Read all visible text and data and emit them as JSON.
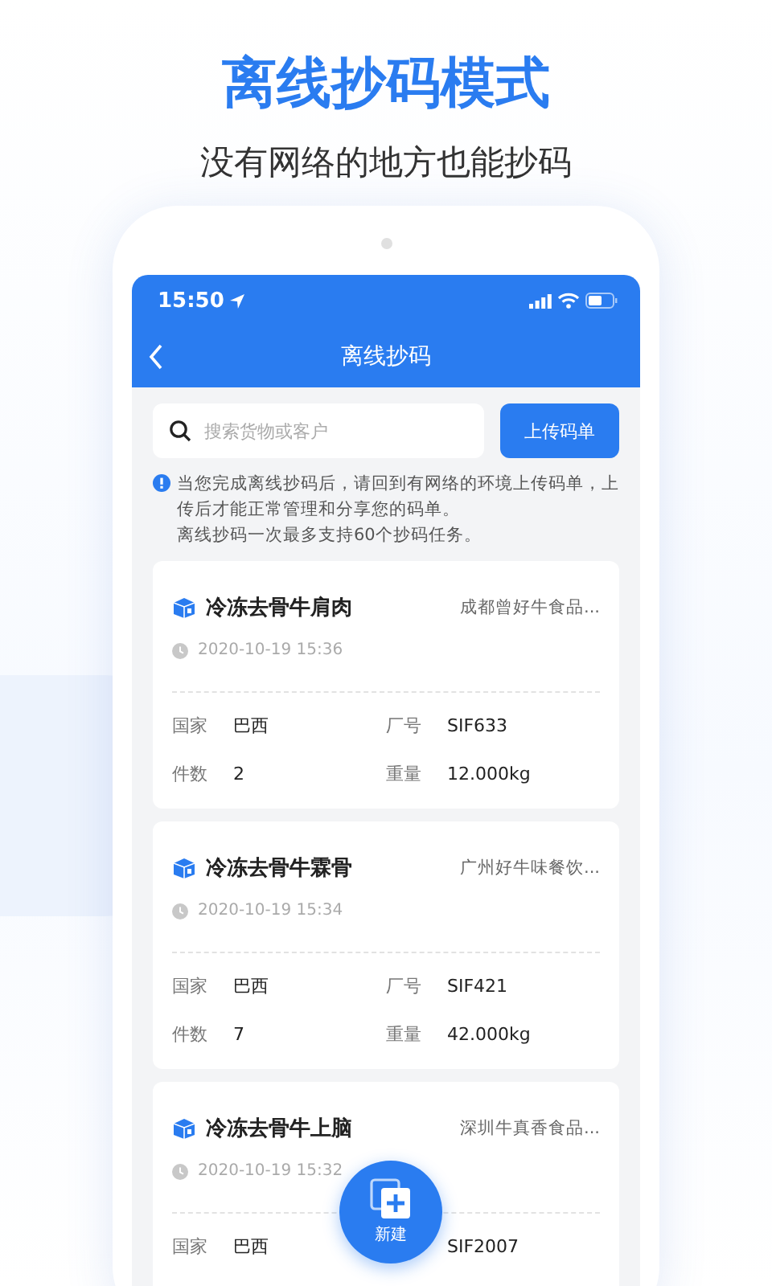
{
  "headline": "离线抄码模式",
  "subheadline": "没有网络的地方也能抄码",
  "status_bar": {
    "time": "15:50"
  },
  "nav": {
    "title": "离线抄码"
  },
  "search": {
    "placeholder": "搜索货物或客户"
  },
  "upload_button": "上传码单",
  "notice": [
    "当您完成离线抄码后，请回到有网络的环境上传码单，上传后才能正常管理和分享您的码单。",
    "离线抄码一次最多支持60个抄码任务。"
  ],
  "records": [
    {
      "name": "冷冻去骨牛肩肉",
      "customer": "成都曾好牛食品...",
      "time": "2020-10-19 15:36",
      "fields": [
        {
          "label": "国家",
          "value": "巴西"
        },
        {
          "label": "厂号",
          "value": "SIF633"
        },
        {
          "label": "件数",
          "value": "2"
        },
        {
          "label": "重量",
          "value": "12.000kg"
        }
      ]
    },
    {
      "name": "冷冻去骨牛霖骨",
      "customer": "广州好牛味餐饮...",
      "time": "2020-10-19 15:34",
      "fields": [
        {
          "label": "国家",
          "value": "巴西"
        },
        {
          "label": "厂号",
          "value": "SIF421"
        },
        {
          "label": "件数",
          "value": "7"
        },
        {
          "label": "重量",
          "value": "42.000kg"
        }
      ]
    },
    {
      "name": "冷冻去骨牛上脑",
      "customer": "深圳牛真香食品...",
      "time": "2020-10-19 15:32",
      "fields": [
        {
          "label": "国家",
          "value": "巴西"
        },
        {
          "value": "SIF2007"
        }
      ]
    }
  ],
  "fab": {
    "label": "新建"
  }
}
